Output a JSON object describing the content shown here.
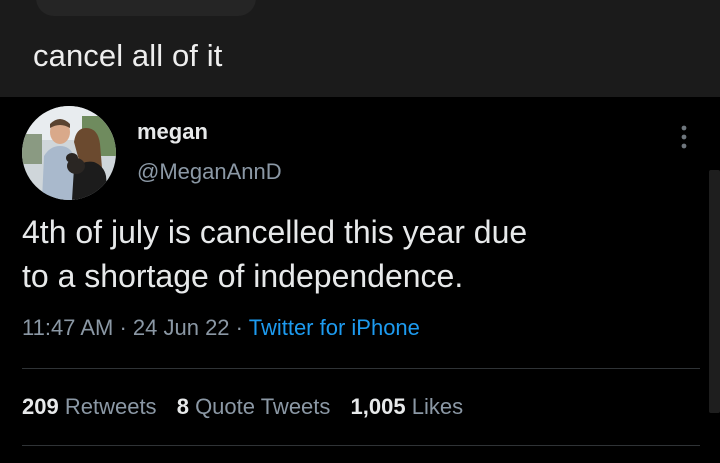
{
  "caption": "cancel all of it",
  "tweet": {
    "display_name": "megan",
    "handle": "@MeganAnnD",
    "text_line1": "4th of july is cancelled this year due",
    "text_line2": "to a shortage of independence.",
    "time": "11:47 AM",
    "separator": "·",
    "date": "24 Jun 22",
    "source": "Twitter for iPhone",
    "stats": {
      "retweets_count": "209",
      "retweets_label": "Retweets",
      "quote_count": "8",
      "quote_label": "Quote Tweets",
      "likes_count": "1,005",
      "likes_label": "Likes"
    }
  },
  "colors": {
    "background": "#000000",
    "top_panel": "#1b1b1b",
    "text_primary": "#e7e9ea",
    "text_secondary": "#8b98a5",
    "link": "#1d9bf0"
  },
  "icons": {
    "more": "more-vertical-icon"
  }
}
